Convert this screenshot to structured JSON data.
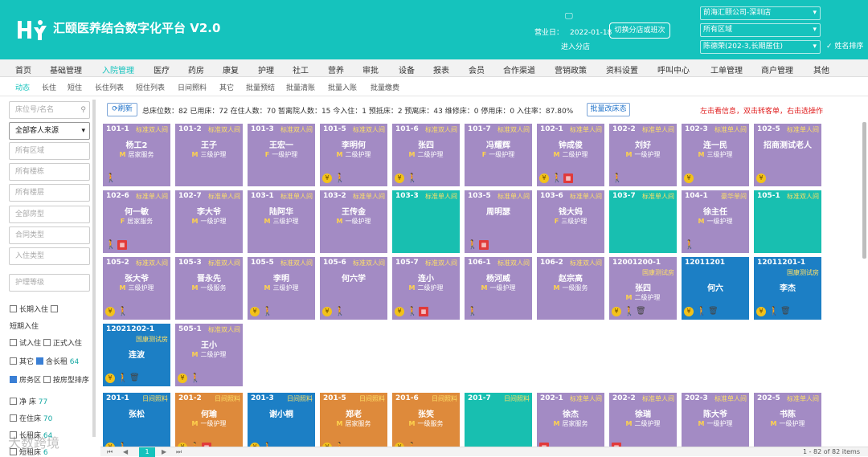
{
  "header": {
    "title": "汇颐医养结合数字化平台 V2.0",
    "biz_label": "营业日：",
    "biz_date": "2022-01-18",
    "enter_branch": "进入分店",
    "switch_btn": "切换分店或班次",
    "company_select": "前海汇颐公司-深圳店",
    "area_select": "所有区域",
    "user_select": "陈德荣(202-3,长期居住)",
    "name_sort_label": "姓名排序",
    "accent_color": "#15c3bd"
  },
  "nav": {
    "items": [
      "首页",
      "基础管理",
      "入院管理",
      "医疗",
      "药房",
      "康复",
      "护理",
      "社工",
      "营养",
      "审批",
      "设备",
      "报表",
      "会员",
      "合作渠道",
      "营销政策",
      "资料设置",
      "呼叫中心",
      "工单管理",
      "商户管理",
      "其他"
    ],
    "active": "入院管理"
  },
  "subnav": {
    "items": [
      "动态",
      "长住",
      "短住",
      "长住列表",
      "短住列表",
      "日间照料",
      "其它",
      "批量预结",
      "批量清账",
      "批量入账",
      "批量缴费"
    ],
    "active": "动态"
  },
  "side": {
    "search_placeholder": "床位号/名名",
    "source_select": "全部客人来源",
    "placeholders": [
      "所有区域",
      "所有楼栋",
      "所有楼层",
      "全部房型",
      "合同类型",
      "入住类型",
      "护理等级"
    ],
    "checks": [
      {
        "label": "长期入住",
        "checked": false
      },
      {
        "label": "短期入住",
        "checked": false
      },
      {
        "label": "试入住",
        "checked": false
      },
      {
        "label": "正式入住",
        "checked": false
      },
      {
        "label": "其它",
        "checked": false
      },
      {
        "label": "含长租",
        "checked": true,
        "count": "64"
      },
      {
        "label": "房务区",
        "checked": true
      },
      {
        "label": "按房型排序",
        "checked": false
      }
    ],
    "counts": [
      {
        "label": "净 床",
        "value": "77"
      },
      {
        "label": "在住床",
        "value": "70"
      },
      {
        "label": "长租床",
        "value": "64"
      },
      {
        "label": "短租床",
        "value": "6"
      }
    ]
  },
  "toolbar": {
    "refresh": "刷新",
    "stats": "总床位数：82  已用床：72  在住人数：70  暂离院人数：15  今入住：1  预抵床：2  预离床：43  维修床：0  停用床：0  入住率：87.80%",
    "batch_btn": "批量改床态",
    "hint": "左击看信息，双击转客单，右击选操作"
  },
  "cards": [
    {
      "room": "101-1",
      "type": "标准双人间",
      "name": "杨工2",
      "care": "M 居家服务",
      "color": "pu",
      "icons": [
        "walk"
      ]
    },
    {
      "room": "101-2",
      "type": "标准双人间",
      "name": "王子",
      "care": "M 三级护理",
      "color": "pu",
      "icons": []
    },
    {
      "room": "101-3",
      "type": "标准双人间",
      "name": "王宏一",
      "care": "F 一级护理",
      "color": "pu",
      "icons": []
    },
    {
      "room": "101-5",
      "type": "标准双人间",
      "name": "李明何",
      "care": "M 二级护理",
      "color": "pu",
      "icons": [
        "coin",
        "walk"
      ]
    },
    {
      "room": "101-6",
      "type": "标准双人间",
      "name": "张四",
      "care": "M 二级护理",
      "color": "pu",
      "icons": [
        "coin",
        "walk"
      ]
    },
    {
      "room": "101-7",
      "type": "标准双人间",
      "name": "冯耀辉",
      "care": "F 一级护理",
      "color": "pu",
      "icons": []
    },
    {
      "room": "102-1",
      "type": "标准单人间",
      "name": "钟成俊",
      "care": "M 二级护理",
      "color": "pu",
      "icons": [
        "coin",
        "walk",
        "doc"
      ]
    },
    {
      "room": "102-2",
      "type": "标准单人间",
      "name": "刘好",
      "care": "M 一级护理",
      "color": "pu",
      "icons": [
        "walk"
      ]
    },
    {
      "room": "102-3",
      "type": "标准单人间",
      "name": "连一民",
      "care": "M 三级护理",
      "color": "pu",
      "icons": [
        "coin"
      ]
    },
    {
      "room": "102-5",
      "type": "标准单人间",
      "name": "招商测试老人",
      "care": "",
      "color": "pu",
      "icons": [
        "coin"
      ]
    },
    {
      "room": "102-6",
      "type": "标准单人间",
      "name": "何一敏",
      "care": "F 居家服务",
      "color": "pu",
      "icons": [
        "walk",
        "doc"
      ]
    },
    {
      "room": "102-7",
      "type": "标准单人间",
      "name": "李大爷",
      "care": "M 一级护理",
      "color": "pu",
      "icons": []
    },
    {
      "room": "103-1",
      "type": "标准单人间",
      "name": "陆阿华",
      "care": "M 三级护理",
      "color": "pu",
      "icons": []
    },
    {
      "room": "103-2",
      "type": "标准单人间",
      "name": "王传金",
      "care": "M 一级护理",
      "color": "pu",
      "icons": []
    },
    {
      "room": "103-3",
      "type": "标准单人间",
      "name": "",
      "care": "",
      "color": "te",
      "icons": []
    },
    {
      "room": "103-5",
      "type": "标准单人间",
      "name": "周明瑟",
      "care": "",
      "color": "pu",
      "icons": [
        "walk",
        "doc"
      ]
    },
    {
      "room": "103-6",
      "type": "标准单人间",
      "name": "钱大妈",
      "care": "F 三级护理",
      "color": "pu",
      "icons": []
    },
    {
      "room": "103-7",
      "type": "标准单人间",
      "name": "",
      "care": "",
      "color": "te",
      "icons": []
    },
    {
      "room": "104-1",
      "type": "豪华单间",
      "name": "徐主任",
      "care": "M 一级护理",
      "color": "pu",
      "icons": [
        "walk"
      ]
    },
    {
      "room": "105-1",
      "type": "标准双人间",
      "name": "",
      "care": "",
      "color": "te",
      "icons": []
    },
    {
      "room": "105-2",
      "type": "标准双人间",
      "name": "张大爷",
      "care": "M 三级护理",
      "color": "pu",
      "icons": [
        "coin",
        "walk"
      ]
    },
    {
      "room": "105-3",
      "type": "标准双人间",
      "name": "晋永先",
      "care": "M 一级服务",
      "color": "pu",
      "icons": []
    },
    {
      "room": "105-5",
      "type": "标准双人间",
      "name": "李明",
      "care": "M 三级护理",
      "color": "pu",
      "icons": [
        "coin",
        "walk"
      ]
    },
    {
      "room": "105-6",
      "type": "标准双人间",
      "name": "何六学",
      "care": "",
      "color": "pu",
      "icons": [
        "coin",
        "walk"
      ]
    },
    {
      "room": "105-7",
      "type": "标准双人间",
      "name": "连小",
      "care": "M 二级护理",
      "color": "pu",
      "icons": [
        "coin",
        "walk",
        "doc"
      ]
    },
    {
      "room": "106-1",
      "type": "标准双人间",
      "name": "杨河威",
      "care": "M 一级护理",
      "color": "pu",
      "icons": [
        "walk"
      ]
    },
    {
      "room": "106-2",
      "type": "标准双人间",
      "name": "赵宗高",
      "care": "M 一级服务",
      "color": "pu",
      "icons": []
    },
    {
      "room": "12001200-1",
      "type": "国康测试房",
      "name": "张四",
      "care": "M 二级护理",
      "color": "pu",
      "icons": [
        "coin",
        "walk",
        "bin"
      ]
    },
    {
      "room": "12011201",
      "type": "",
      "name": "何六",
      "care": "",
      "color": "bl",
      "icons": [
        "coin",
        "walk",
        "bin"
      ]
    },
    {
      "room": "12011201-1",
      "type": "国康测试房",
      "name": "李杰",
      "care": "",
      "color": "bl",
      "icons": [
        "coin",
        "walk",
        "bin"
      ]
    },
    {
      "room": "12021202-1",
      "type": "国康测试房",
      "name": "连波",
      "care": "",
      "color": "bl",
      "icons": [
        "coin",
        "walk",
        "bin"
      ]
    },
    {
      "room": "505-1",
      "type": "标准双人间",
      "name": "王小",
      "care": "M 二级护理",
      "color": "pu",
      "icons": [
        "coin",
        "walk"
      ]
    },
    {
      "room": "201-1",
      "type": "日间照料",
      "name": "张松",
      "care": "",
      "color": "bl",
      "icons": [
        "coin",
        "walk"
      ]
    },
    {
      "room": "201-2",
      "type": "日间照料",
      "name": "何瑜",
      "care": "M 一级护理",
      "color": "or",
      "icons": [
        "coin",
        "walk",
        "doc"
      ]
    },
    {
      "room": "201-3",
      "type": "日间照料",
      "name": "谢小桐",
      "care": "",
      "color": "bl",
      "icons": [
        "coin",
        "walk"
      ]
    },
    {
      "room": "201-5",
      "type": "日间照料",
      "name": "郑老",
      "care": "M 居家服务",
      "color": "or",
      "icons": [
        "coin",
        "walk"
      ]
    },
    {
      "room": "201-6",
      "type": "日间照料",
      "name": "张笑",
      "care": "M 一级服务",
      "color": "or",
      "icons": [
        "coin",
        "walk"
      ]
    },
    {
      "room": "201-7",
      "type": "日间照料",
      "name": "",
      "care": "",
      "color": "te",
      "icons": []
    },
    {
      "room": "202-1",
      "type": "标准单人间",
      "name": "徐杰",
      "care": "M 居家服务",
      "color": "pu",
      "icons": [
        "doc"
      ]
    },
    {
      "room": "202-2",
      "type": "标准单人间",
      "name": "徐瑞",
      "care": "M 二级护理",
      "color": "pu",
      "icons": [
        "doc"
      ]
    },
    {
      "room": "202-3",
      "type": "标准单人间",
      "name": "陈大爷",
      "care": "M 一级护理",
      "color": "pu",
      "icons": []
    },
    {
      "room": "202-5",
      "type": "标准单人间",
      "name": "书陈",
      "care": "M 一级护理",
      "color": "pu",
      "icons": []
    }
  ],
  "pager": {
    "current": "1",
    "count": "1 - 82 of 82 items"
  },
  "watermark": "大数跨境"
}
